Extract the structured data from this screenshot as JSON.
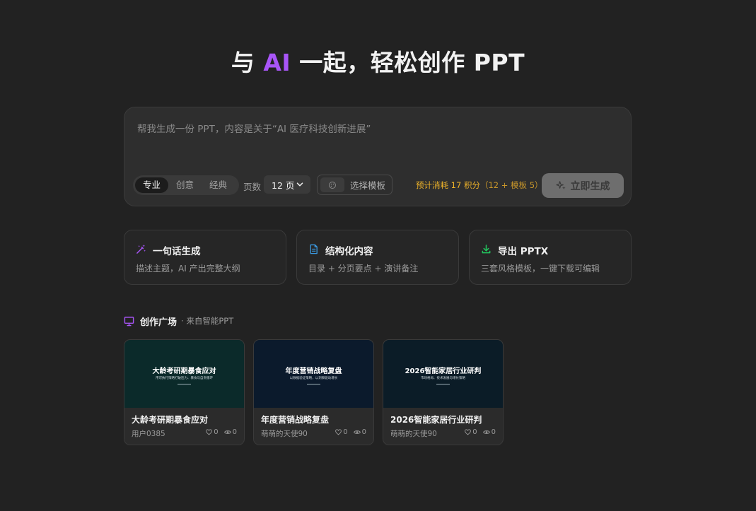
{
  "hero": {
    "prefix": "与",
    "ai": "AI",
    "suffix": "一起，轻松创作 PPT"
  },
  "prompt": {
    "placeholder": "帮我生成一份 PPT，内容是关于“AI 医疗科技创新进展”"
  },
  "styles": [
    {
      "label": "专业",
      "active": true
    },
    {
      "label": "创意"
    },
    {
      "label": "经典"
    }
  ],
  "pages": {
    "label": "页数",
    "value": "12 页"
  },
  "template": {
    "label": "选择模板"
  },
  "cost": {
    "main": "预计消耗 17 积分",
    "detail": "（12 + 模板 5）"
  },
  "generate": {
    "label": "立即生成"
  },
  "features": [
    {
      "title": "一句话生成",
      "desc": "描述主题，AI 产出完整大纲",
      "icon": "magic-wand-icon",
      "color": "#a855f7"
    },
    {
      "title": "结构化内容",
      "desc": "目录 + 分页要点 + 演讲备注",
      "icon": "document-icon",
      "color": "#3b9ae1"
    },
    {
      "title": "导出 PPTX",
      "desc": "三套风格模板，一键下载可编辑",
      "icon": "download-icon",
      "color": "#22c55e"
    }
  ],
  "gallery": {
    "title": "创作广场",
    "subtitle": "· 来自智能PPT",
    "items": [
      {
        "thumb_title": "大龄考研期暴食应对",
        "thumb_sub": "用可执行策略打破压力、暴食与自责循环",
        "title": "大龄考研期暴食应对",
        "author": "用户0385",
        "likes": "0",
        "views": "0",
        "bg": "#0b2a2a"
      },
      {
        "thumb_title": "年度营销战略复盘",
        "thumb_sub": "以数据验证策略，以洞察驱动增长",
        "title": "年度营销战略复盘",
        "author": "萌萌的天使90",
        "likes": "0",
        "views": "0",
        "bg": "#0b1a2c"
      },
      {
        "thumb_title": "2026智能家居行业研判",
        "thumb_sub": "市场格局、技术发展与增长策略",
        "title": "2026智能家居行业研判",
        "author": "萌萌的天使90",
        "likes": "0",
        "views": "0",
        "bg": "#0b1c27"
      }
    ]
  },
  "colors": {
    "accent": "#a855f7",
    "cost": "#f0b429",
    "background": "#222222"
  }
}
